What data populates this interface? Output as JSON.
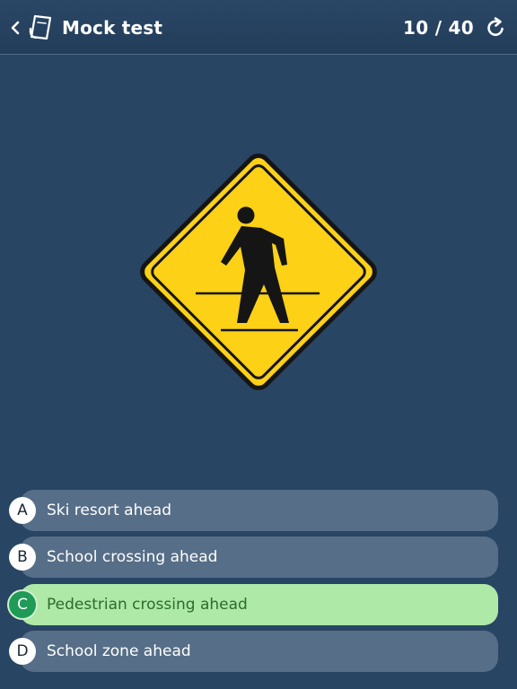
{
  "header": {
    "title": "Mock test",
    "counter": "10 / 40"
  },
  "question": {
    "sign_icon": "pedestrian-crossing-sign"
  },
  "answers": [
    {
      "letter": "A",
      "text": "Ski resort ahead"
    },
    {
      "letter": "B",
      "text": "School crossing ahead"
    },
    {
      "letter": "C",
      "text": "Pedestrian crossing ahead",
      "state": "correct"
    },
    {
      "letter": "D",
      "text": "School zone ahead"
    }
  ],
  "colors": {
    "background": "#284564",
    "answer_default": "#566e87",
    "answer_correct": "#aee9a8",
    "correct_badge": "#1f9a57",
    "sign_yellow": "#fcd116"
  }
}
